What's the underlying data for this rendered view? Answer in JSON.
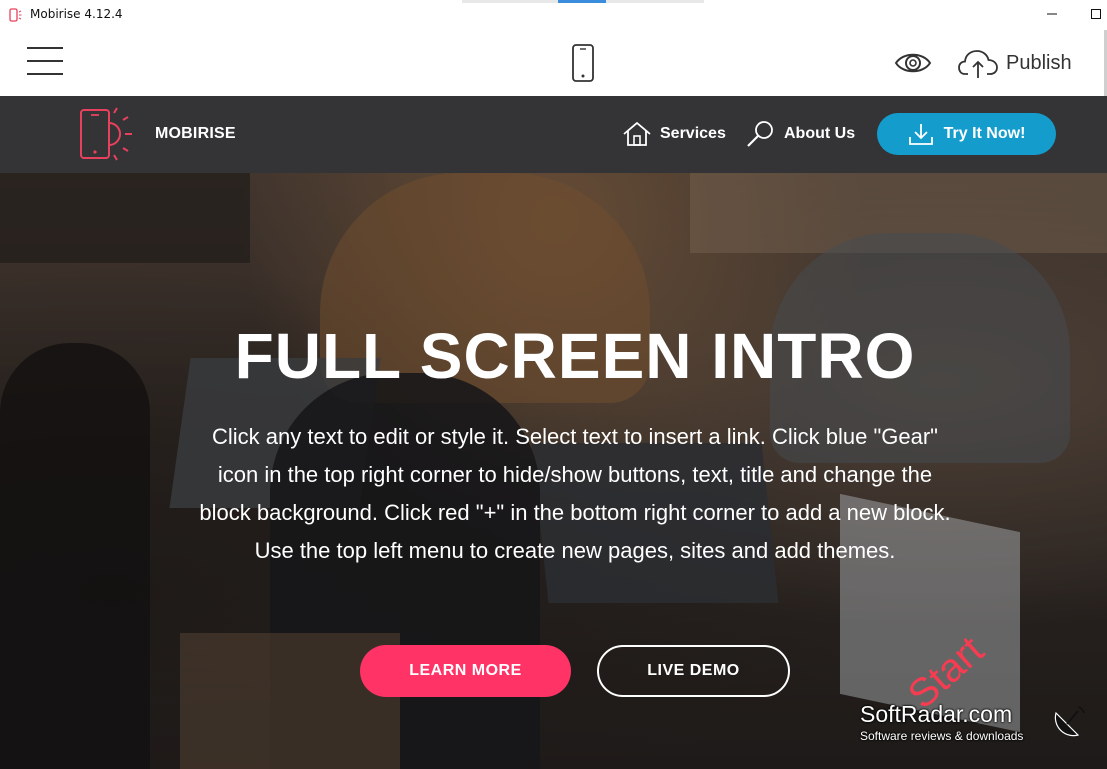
{
  "window": {
    "title": "Mobirise 4.12.4",
    "app_icon": "mobirise-app-icon",
    "controls": [
      "minimize-icon",
      "maximize-icon"
    ]
  },
  "toolbar": {
    "menu_icon": "hamburger-icon",
    "device_icon": "mobile-device-icon",
    "preview_icon": "eye-icon",
    "publish_icon": "cloud-upload-icon",
    "publish_label": "Publish"
  },
  "site_nav": {
    "brand": "MOBIRISE",
    "brand_logo": "phone-sun-logo",
    "links": [
      {
        "label": "Services",
        "icon": "home-icon"
      },
      {
        "label": "About Us",
        "icon": "search-icon"
      }
    ],
    "cta": {
      "label": "Try It Now!",
      "icon": "download-icon"
    }
  },
  "hero": {
    "title": "FULL SCREEN INTRO",
    "text": "Click any text to edit or style it. Select text to insert a link. Click blue \"Gear\" icon in the top right corner to hide/show buttons, text, title and change the block background. Click red \"+\" in the bottom right corner to add a new block. Use the top left menu to create new pages, sites and add themes.",
    "buttons": {
      "primary": "LEARN MORE",
      "secondary": "LIVE DEMO"
    },
    "hint": "Start"
  },
  "watermark": {
    "name": "SoftRadar.com",
    "tagline": "Software reviews & downloads"
  },
  "colors": {
    "nav_bg": "#343437",
    "cta_blue": "#149dcc",
    "primary_pink": "#ff3366",
    "logo_pink": "#e8415d"
  }
}
